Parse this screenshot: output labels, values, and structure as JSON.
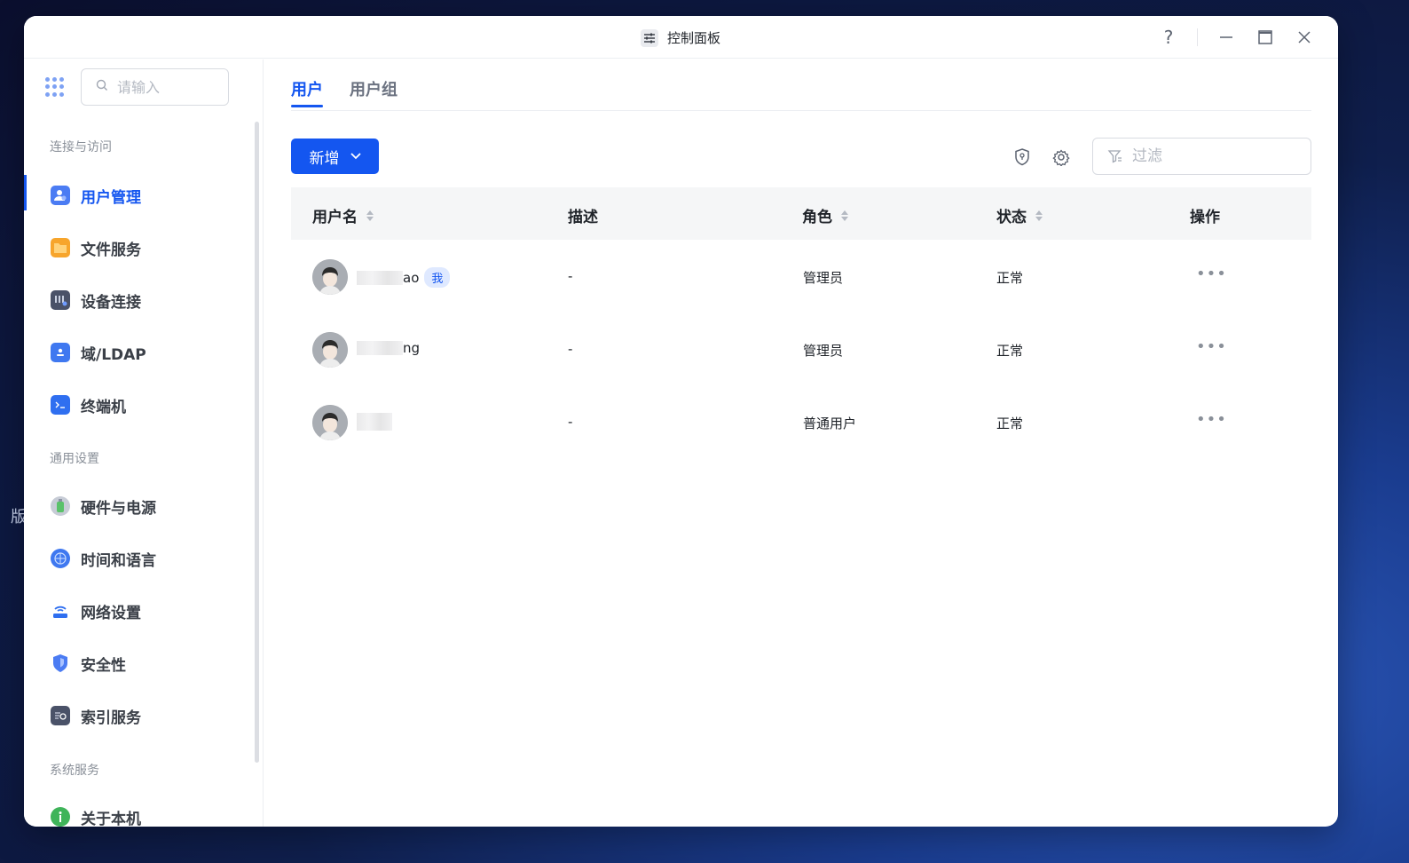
{
  "window": {
    "title": "控制面板",
    "help_glyph": "?",
    "min_glyph": "—",
    "max_glyph": "☐",
    "close_glyph": "✕"
  },
  "background": {
    "side_text": "版"
  },
  "sidebar": {
    "search_placeholder": "请输入",
    "sections": [
      {
        "label": "连接与访问"
      },
      {
        "label": "通用设置"
      },
      {
        "label": "系统服务"
      }
    ],
    "items": [
      {
        "label": "用户管理",
        "icon": "user-manage-icon",
        "active": true
      },
      {
        "label": "文件服务",
        "icon": "folder-icon"
      },
      {
        "label": "设备连接",
        "icon": "device-icon"
      },
      {
        "label": "域/LDAP",
        "icon": "ldap-icon"
      },
      {
        "label": "终端机",
        "icon": "terminal-icon"
      },
      {
        "label": "硬件与电源",
        "icon": "hardware-icon"
      },
      {
        "label": "时间和语言",
        "icon": "globe-icon"
      },
      {
        "label": "网络设置",
        "icon": "network-icon"
      },
      {
        "label": "安全性",
        "icon": "shield-icon"
      },
      {
        "label": "索引服务",
        "icon": "index-icon"
      },
      {
        "label": "关于本机",
        "icon": "info-icon"
      }
    ]
  },
  "main": {
    "tabs": [
      {
        "label": "用户",
        "active": true
      },
      {
        "label": "用户组",
        "active": false
      }
    ],
    "add_button": "新增",
    "filter_placeholder": "过滤",
    "columns": [
      "用户名",
      "描述",
      "角色",
      "状态",
      "操作"
    ],
    "rows": [
      {
        "username_visible": "ao",
        "me_badge": "我",
        "description": "-",
        "role": "管理员",
        "status": "正常",
        "actions": "•••"
      },
      {
        "username_visible": "ng",
        "me_badge": "",
        "description": "-",
        "role": "管理员",
        "status": "正常",
        "actions": "•••"
      },
      {
        "username_visible": "",
        "me_badge": "",
        "description": "-",
        "role": "普通用户",
        "status": "正常",
        "actions": "•••"
      }
    ]
  },
  "colors": {
    "accent": "#1456f0"
  }
}
